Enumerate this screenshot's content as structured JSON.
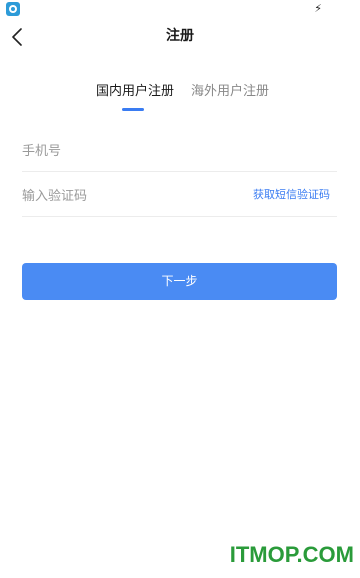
{
  "status_bar": {
    "charge_glyph": "⚡"
  },
  "nav": {
    "title": "注册"
  },
  "tabs": [
    {
      "label": "国内用户注册",
      "active": true
    },
    {
      "label": "海外用户注册",
      "active": false
    }
  ],
  "form": {
    "phone_placeholder": "手机号",
    "code_placeholder": "输入验证码",
    "get_code_label": "获取短信验证码",
    "next_label": "下一步"
  },
  "watermark": "ITMOP.COM",
  "colors": {
    "accent": "#4a8bf3",
    "link": "#3a7cf2",
    "watermark": "#2a9b3a"
  }
}
